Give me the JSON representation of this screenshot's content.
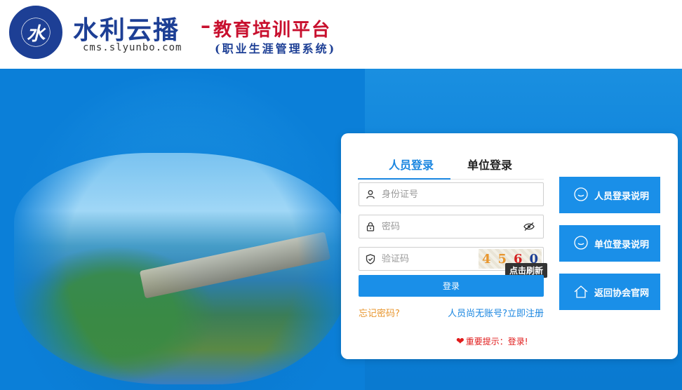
{
  "header": {
    "logo_letter": "水",
    "title": "水利云播",
    "site_url": "cms.slyunbo.com",
    "dash": "–",
    "slogan": "教育培训平台",
    "slogan_sub": "(职业生涯管理系统)"
  },
  "login": {
    "tabs": [
      {
        "label": "人员登录",
        "active": true
      },
      {
        "label": "单位登录",
        "active": false
      }
    ],
    "id_placeholder": "身份证号",
    "password_placeholder": "密码",
    "captcha_placeholder": "验证码",
    "captcha_chars": [
      {
        "char": "4",
        "color": "#e8962e"
      },
      {
        "char": "5",
        "color": "#e8962e"
      },
      {
        "char": "6",
        "color": "#d42020"
      },
      {
        "char": "0",
        "color": "#1d3f95"
      }
    ],
    "captcha_tooltip": "点击刷新",
    "login_button": "登录",
    "forgot_link": "忘记密码?",
    "register_link": "人员尚无账号?立即注册",
    "notice": "重要提示：登录!"
  },
  "side_buttons": [
    {
      "label": "人员登录说明",
      "icon": "chat-bubble-icon"
    },
    {
      "label": "单位登录说明",
      "icon": "chat-bubble-icon"
    },
    {
      "label": "返回协会官网",
      "icon": "home-icon"
    }
  ],
  "colors": {
    "primary": "#1a8fe8",
    "brand_blue": "#1d3f95",
    "brand_red": "#c8102e",
    "forgot": "#e8962e",
    "notice": "#e01b1b"
  }
}
